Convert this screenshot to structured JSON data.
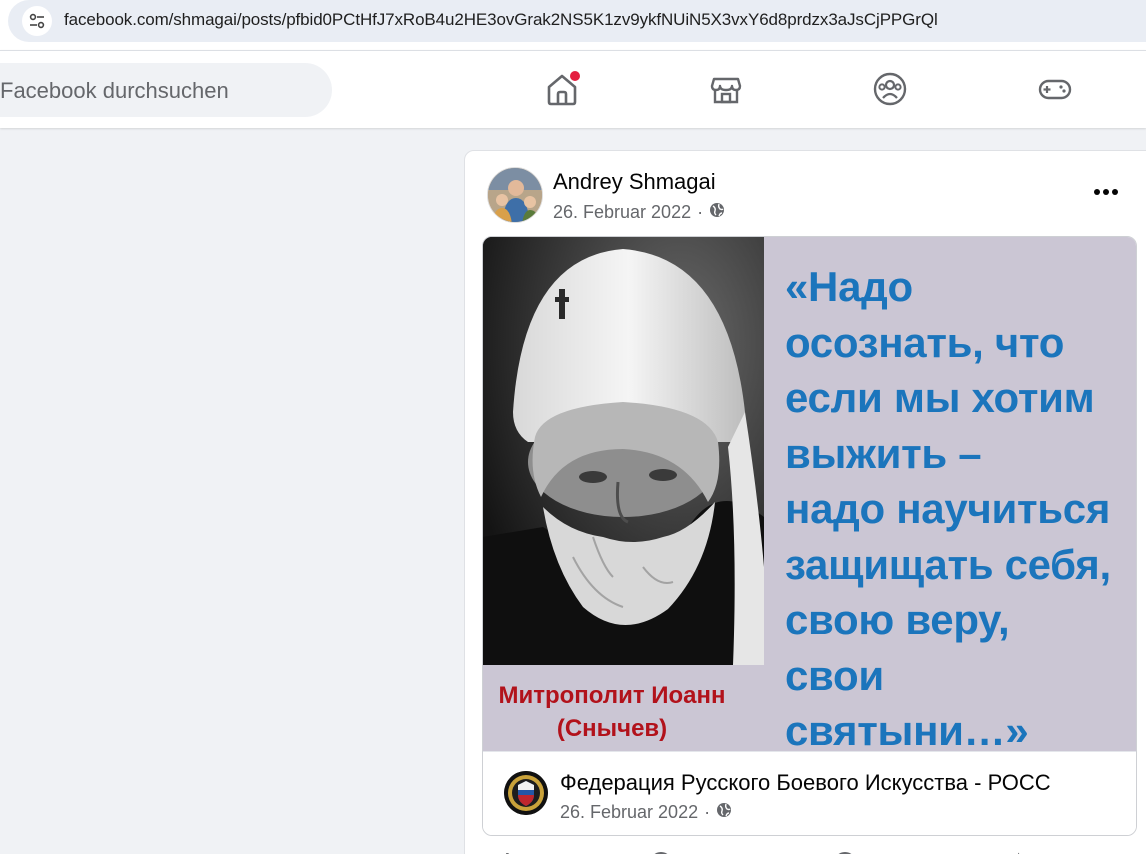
{
  "browser": {
    "url": "facebook.com/shmagai/posts/pfbid0PCtHfJ7xRoB4u2HE3ovGrak2NS5K1zv9ykfNUiN5X3vxY6d8prdzx3aJsCjPPGrQl",
    "site_settings_icon": "tune-icon"
  },
  "header": {
    "search_placeholder": "Facebook durchsuchen",
    "nav": [
      {
        "name": "home",
        "icon": "home-icon",
        "has_notification": true
      },
      {
        "name": "marketplace",
        "icon": "store-icon"
      },
      {
        "name": "groups",
        "icon": "groups-icon"
      },
      {
        "name": "gaming",
        "icon": "gamepad-icon"
      }
    ],
    "notification_color": "#e41e3f"
  },
  "post": {
    "author": "Andrey Shmagai",
    "date": "26. Februar 2022",
    "separator": "·",
    "privacy_icon": "globe-icon",
    "more_icon": "more-horizontal-icon",
    "shared": {
      "quote_lines": [
        "«Надо",
        "осознать, что",
        "если мы хотим",
        "выжить –",
        "надо научиться",
        "защищать себя,",
        "свою веру,",
        "свои",
        "святыни…»"
      ],
      "caption_lines": [
        "Митрополит Иоанн",
        "(Снычев)"
      ],
      "page_name": "Федерация Русского Боевого Искусства - РОСС",
      "page_date": "26. Februar 2022",
      "page_separator": "·"
    }
  },
  "colors": {
    "quote": "#1b75bc",
    "caption": "#b2121b",
    "image_bg": "#cbc6d4"
  }
}
